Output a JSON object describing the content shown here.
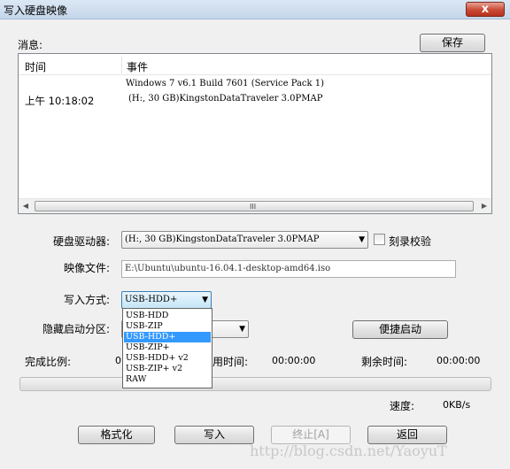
{
  "window": {
    "title": "写入硬盘映像",
    "close_label": "x"
  },
  "messages": {
    "label": "消息:",
    "save_label": "保存",
    "columns": [
      "时间",
      "事件"
    ],
    "rows": [
      {
        "time": "",
        "event": "Windows 7 v6.1 Build 7601 (Service Pack 1)"
      },
      {
        "time": "上午 10:18:02",
        "event": "(H:, 30 GB)KingstonDataTraveler 3.0PMAP"
      }
    ],
    "scroll_grip": "III"
  },
  "form": {
    "drive_label": "硬盘驱动器:",
    "drive_value": "(H:, 30 GB)KingstonDataTraveler 3.0PMAP",
    "verify_label": "刻录校验",
    "verify_checked": false,
    "image_label": "映像文件:",
    "image_value": "E:\\Ubuntu\\ubuntu-16.04.1-desktop-amd64.iso",
    "write_mode_label": "写入方式:",
    "write_mode_value": "USB-HDD+",
    "write_mode_options": [
      "USB-HDD",
      "USB-ZIP",
      "USB-HDD+",
      "USB-ZIP+",
      "USB-HDD+ v2",
      "USB-ZIP+ v2",
      "RAW"
    ],
    "write_mode_selected_index": 2,
    "hidden_partition_label": "隐藏启动分区:",
    "quick_boot_label": "便捷启动"
  },
  "status": {
    "complete_label": "完成比例:",
    "complete_value": "0",
    "elapsed_label_tail": "用时间:",
    "elapsed_value": "00:00:00",
    "remaining_label": "剩余时间:",
    "remaining_value": "00:00:00",
    "speed_label": "速度:",
    "speed_value": "0KB/s",
    "progress_fraction": 0
  },
  "actions": {
    "format_label": "格式化",
    "write_label": "写入",
    "stop_label": "终止[A]",
    "back_label": "返回"
  },
  "watermark": "http://blog.csdn.net/YaoyuT"
}
